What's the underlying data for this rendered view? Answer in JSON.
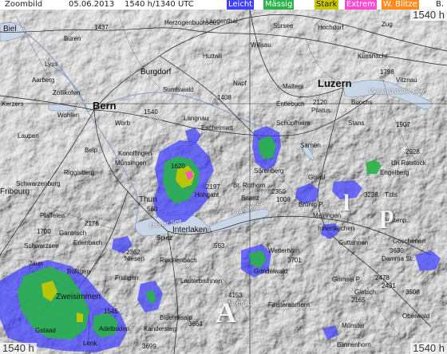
{
  "header": {
    "product": "Zoombild",
    "date": "05.06.2013",
    "time": "1540 h/1340 UTC",
    "legend": [
      {
        "label": "Leicht",
        "color": "#4040ff"
      },
      {
        "label": "Mässig",
        "color": "#29b34a"
      },
      {
        "label": "Stark",
        "color": "#c8c800"
      },
      {
        "label": "Extrem",
        "color": "#ff4bd2"
      },
      {
        "label": "W. Blitze",
        "color": "#ff8c1a"
      },
      {
        "label": "B.",
        "color": "#ffffff"
      }
    ]
  },
  "stamps": {
    "top_right": "1540 h",
    "bottom_left": "1540 h",
    "bottom_right": "1540 h"
  },
  "places": [
    {
      "name": "Biel",
      "style": "mid"
    },
    {
      "name": "Büren"
    },
    {
      "name": "Lyss"
    },
    {
      "name": "Aarberg"
    },
    {
      "name": "Kerzers"
    },
    {
      "name": "Zollikofen"
    },
    {
      "name": "Laupen"
    },
    {
      "name": "Bern",
      "style": "big"
    },
    {
      "name": "Worb"
    },
    {
      "name": "Belp"
    },
    {
      "name": "Konolfingen"
    },
    {
      "name": "Münsingen"
    },
    {
      "name": "Riggisberg"
    },
    {
      "name": "Schwarzenburg"
    },
    {
      "name": "Fribourg",
      "style": "mid"
    },
    {
      "name": "Plaffeien"
    },
    {
      "name": "Gantrisch"
    },
    {
      "name": "Erlenbach"
    },
    {
      "name": "Schwarzsee"
    },
    {
      "name": "Langenthal"
    },
    {
      "name": "Burgdorf",
      "style": "mid"
    },
    {
      "name": "Huttwil"
    },
    {
      "name": "Sumiswald"
    },
    {
      "name": "Langnau"
    },
    {
      "name": "Eschelmatt"
    },
    {
      "name": "Napf"
    },
    {
      "name": "Herzogenbuchsee"
    },
    {
      "name": "Wilisau"
    },
    {
      "name": "Sursee"
    },
    {
      "name": "Hochdorf"
    },
    {
      "name": "Luzern",
      "style": "mid"
    },
    {
      "name": "Malters"
    },
    {
      "name": "Entlebuch"
    },
    {
      "name": "Schüpfheim"
    },
    {
      "name": "Pilatus"
    },
    {
      "name": "Stans"
    },
    {
      "name": "Sarnen"
    },
    {
      "name": "Küssnacht"
    },
    {
      "name": "Zug"
    },
    {
      "name": "Vitznau"
    },
    {
      "name": "Buochs"
    },
    {
      "name": "Vierwaldstätter See"
    },
    {
      "name": "Uri Rotstock"
    },
    {
      "name": "Engelberg"
    },
    {
      "name": "Titlis"
    },
    {
      "name": "Sörenberg"
    },
    {
      "name": "Giswil"
    },
    {
      "name": "Brünig P."
    },
    {
      "name": "Meiringen"
    },
    {
      "name": "Thun",
      "style": "mid"
    },
    {
      "name": "Hohgant"
    },
    {
      "name": "Br. Rothorn"
    },
    {
      "name": "Brienz"
    },
    {
      "name": "Interlaken",
      "style": "mid"
    },
    {
      "name": "Spiez"
    },
    {
      "name": "Niesen"
    },
    {
      "name": "Reichenbach"
    },
    {
      "name": "Frutigen"
    },
    {
      "name": "Lauterbrunnen"
    },
    {
      "name": "Blüemlisalp"
    },
    {
      "name": "Kandersteg"
    },
    {
      "name": "Grindelwald"
    },
    {
      "name": "Wetterhorn"
    },
    {
      "name": "Jungfrau"
    },
    {
      "name": "Finsteraarhorn"
    },
    {
      "name": "Innertkirchen"
    },
    {
      "name": "Guttannen"
    },
    {
      "name": "Sustenp."
    },
    {
      "name": "Göschenen"
    },
    {
      "name": "Damma St."
    },
    {
      "name": "Grimsel P."
    },
    {
      "name": "Gletsch"
    },
    {
      "name": "Oberwald"
    },
    {
      "name": "Münster"
    },
    {
      "name": "Blinnenhorn"
    },
    {
      "name": "Jaun"
    },
    {
      "name": "Boltigen"
    },
    {
      "name": "Zweisimmen"
    },
    {
      "name": "Gstaad"
    },
    {
      "name": "Lenk"
    },
    {
      "name": "Adelboden"
    },
    {
      "name": "Brienzer See"
    },
    {
      "name": "Thuner See"
    },
    {
      "name": "Emme"
    },
    {
      "name": "Aare"
    },
    {
      "name": "Wohlen"
    }
  ],
  "elevations": [
    "1437",
    "1408",
    "2197",
    "2350",
    "1008",
    "2120",
    "1798",
    "1907",
    "2928",
    "3238",
    "2176",
    "2362",
    "563",
    "560",
    "1540",
    "4153",
    "3664",
    "3699",
    "3701",
    "3630",
    "2431",
    "2478",
    "2165",
    "3508",
    "1620",
    "1700",
    "1545"
  ],
  "massif_label_1": "A",
  "massif_label_2": "l",
  "massif_label_3": "p",
  "massif_label_4": "A"
}
